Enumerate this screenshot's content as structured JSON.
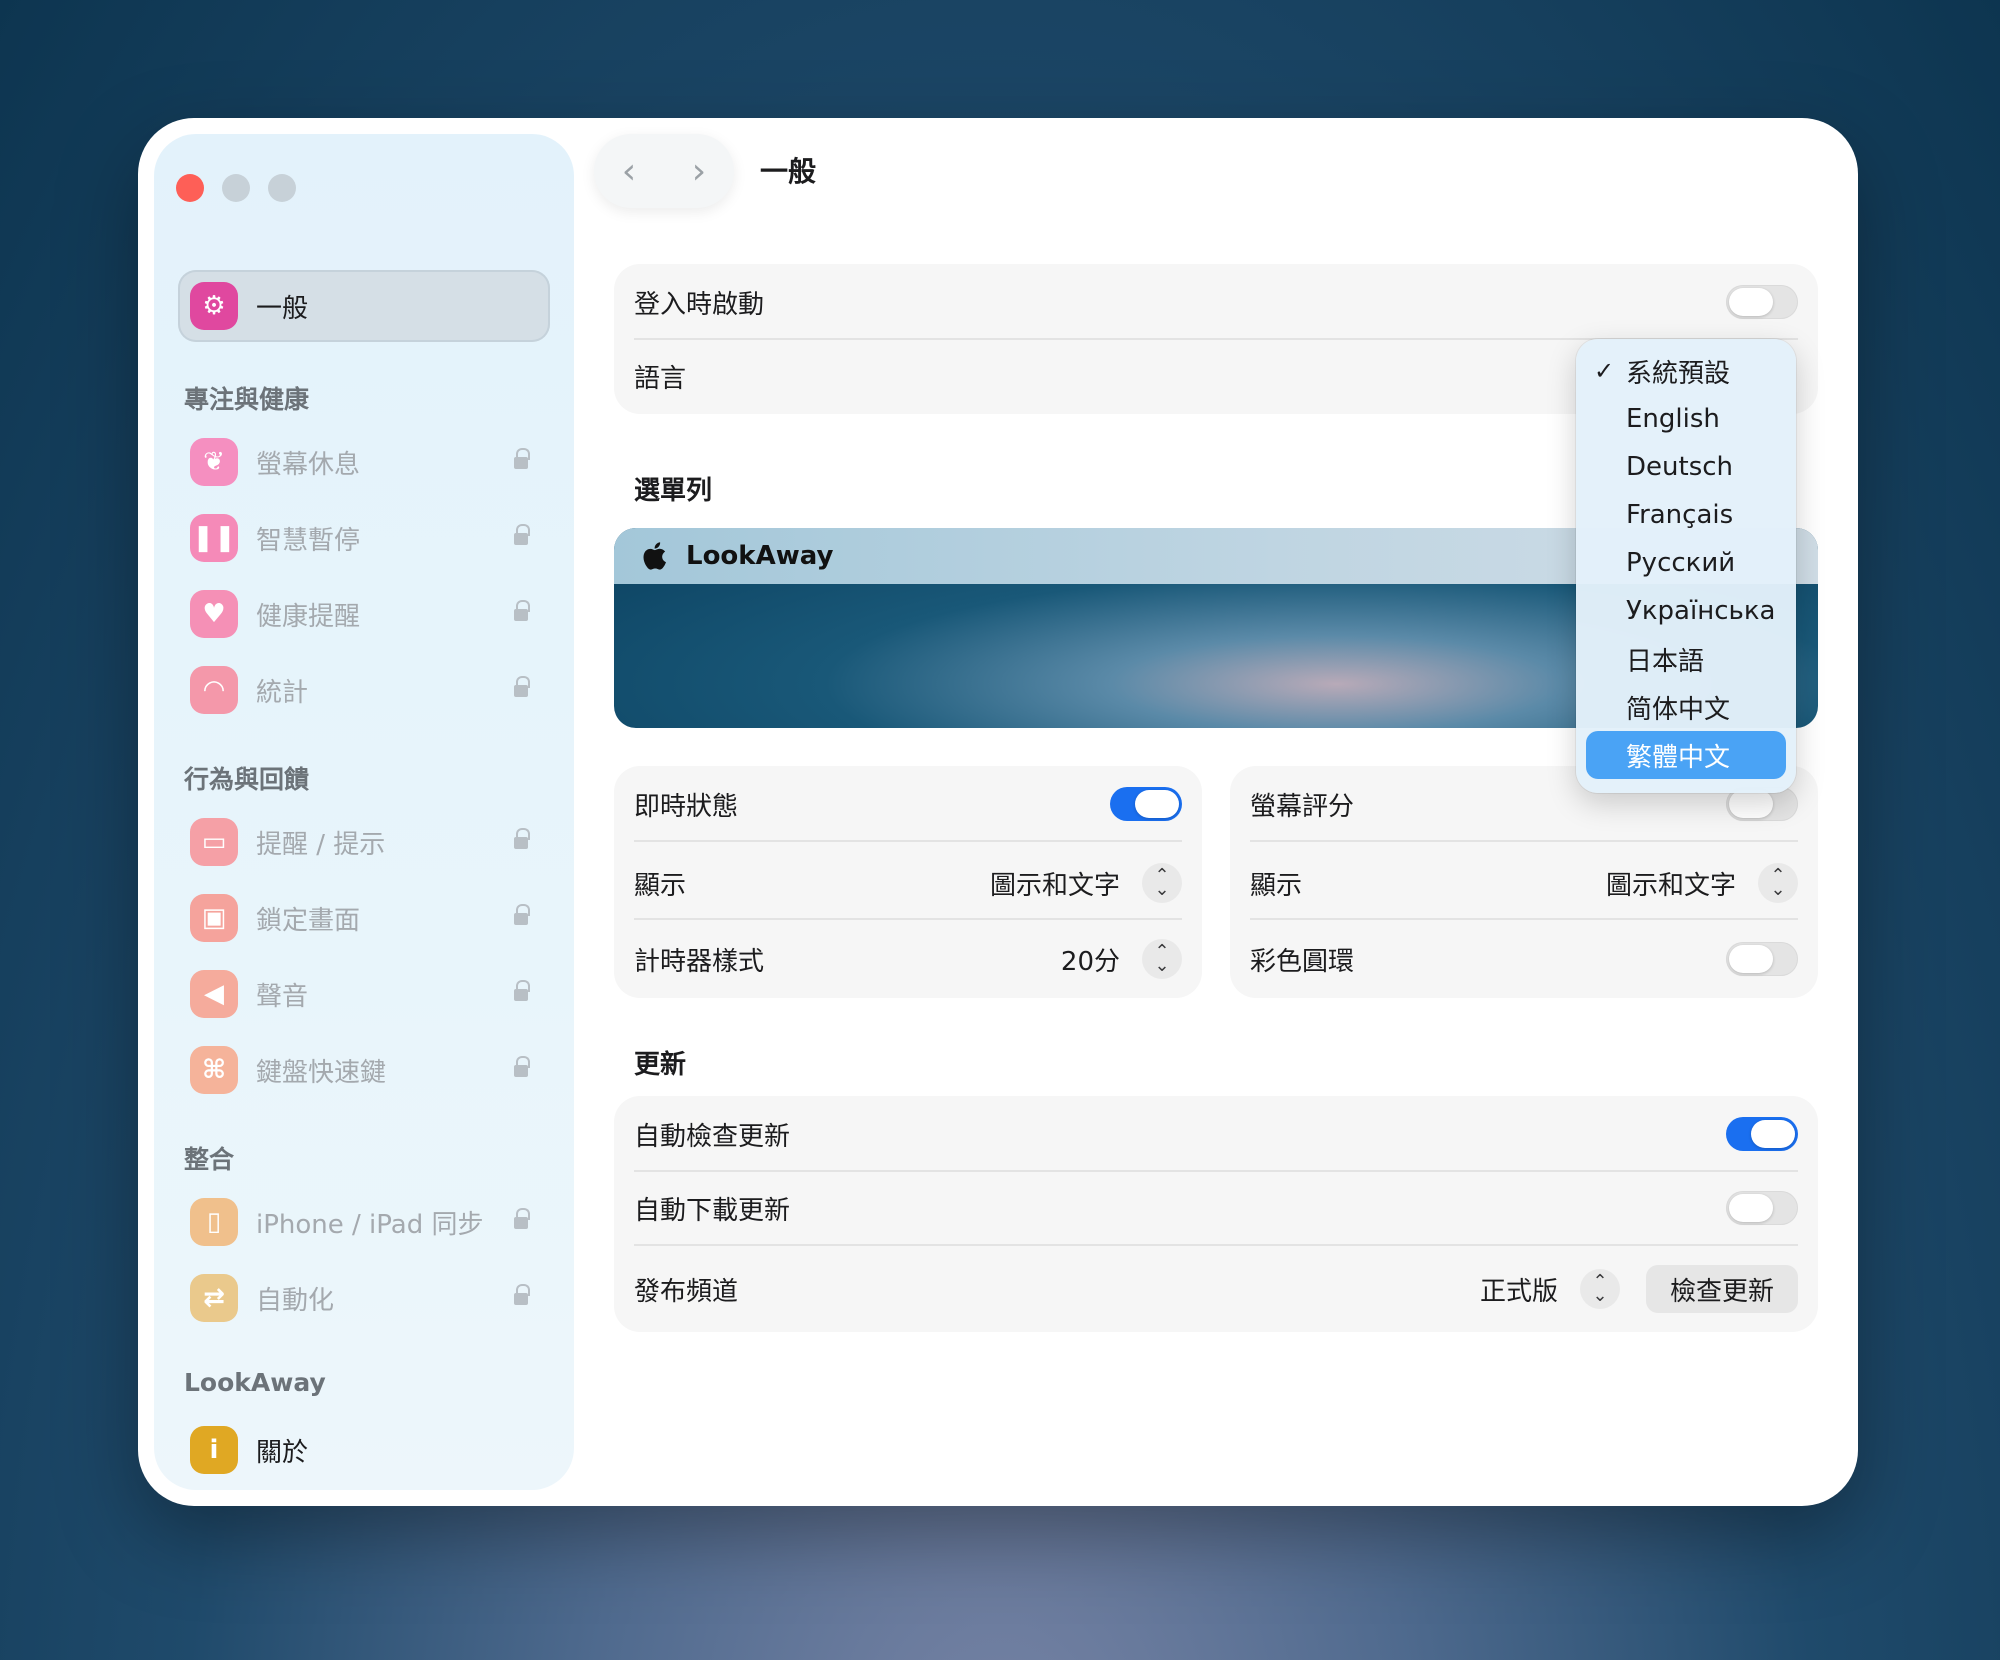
{
  "window": {
    "title": "一般"
  },
  "sidebar": {
    "selected": {
      "label": "一般",
      "icon": "gear-icon",
      "color": "#e0489f"
    },
    "sections": [
      {
        "header": "專注與健康",
        "items": [
          {
            "label": "螢幕休息",
            "icon": "leaf-icon",
            "color": "#f58fc0"
          },
          {
            "label": "智慧暫停",
            "icon": "pause-icon",
            "color": "#f58ab8"
          },
          {
            "label": "健康提醒",
            "icon": "heart-icon",
            "color": "#f590b6"
          },
          {
            "label": "統計",
            "icon": "gauge-icon",
            "color": "#f498aa"
          }
        ]
      },
      {
        "header": "行為與回饋",
        "items": [
          {
            "label": "提醒 / 提示",
            "icon": "card-icon",
            "color": "#f5a0a6"
          },
          {
            "label": "鎖定畫面",
            "icon": "lock-icon",
            "color": "#f5a39c"
          },
          {
            "label": "聲音",
            "icon": "speaker-icon",
            "color": "#f5ab9c"
          },
          {
            "label": "鍵盤快速鍵",
            "icon": "command-icon",
            "color": "#f5b39a"
          }
        ]
      },
      {
        "header": "整合",
        "items": [
          {
            "label": "iPhone / iPad 同步",
            "icon": "phone-icon",
            "color": "#f0c08c"
          },
          {
            "label": "自動化",
            "icon": "repeat-icon",
            "color": "#eac98c"
          }
        ]
      },
      {
        "header": "LookAway",
        "items": [
          {
            "label": "關於",
            "icon": "info-icon",
            "color": "#e0a823"
          }
        ]
      }
    ]
  },
  "general": {
    "launch_at_login": "登入時啟動",
    "language": "語言"
  },
  "language_menu": {
    "options": [
      "系統預設",
      "English",
      "Deutsch",
      "Français",
      "Русский",
      "Українська",
      "日本語",
      "简体中文",
      "繁體中文"
    ],
    "checked": "系統預設",
    "highlighted": "繁體中文"
  },
  "menubar": {
    "header": "選單列",
    "app_name": "LookAway"
  },
  "live_status": {
    "title": "即時狀態",
    "display_label": "顯示",
    "display_value": "圖示和文字",
    "timer_label": "計時器樣式",
    "timer_value": "20分"
  },
  "screen_score": {
    "title": "螢幕評分",
    "display_label": "顯示",
    "display_value": "圖示和文字",
    "color_ring_label": "彩色圓環"
  },
  "updates": {
    "header": "更新",
    "auto_check": "自動檢查更新",
    "auto_download": "自動下載更新",
    "channel_label": "發布頻道",
    "channel_value": "正式版",
    "check_button": "檢查更新"
  }
}
